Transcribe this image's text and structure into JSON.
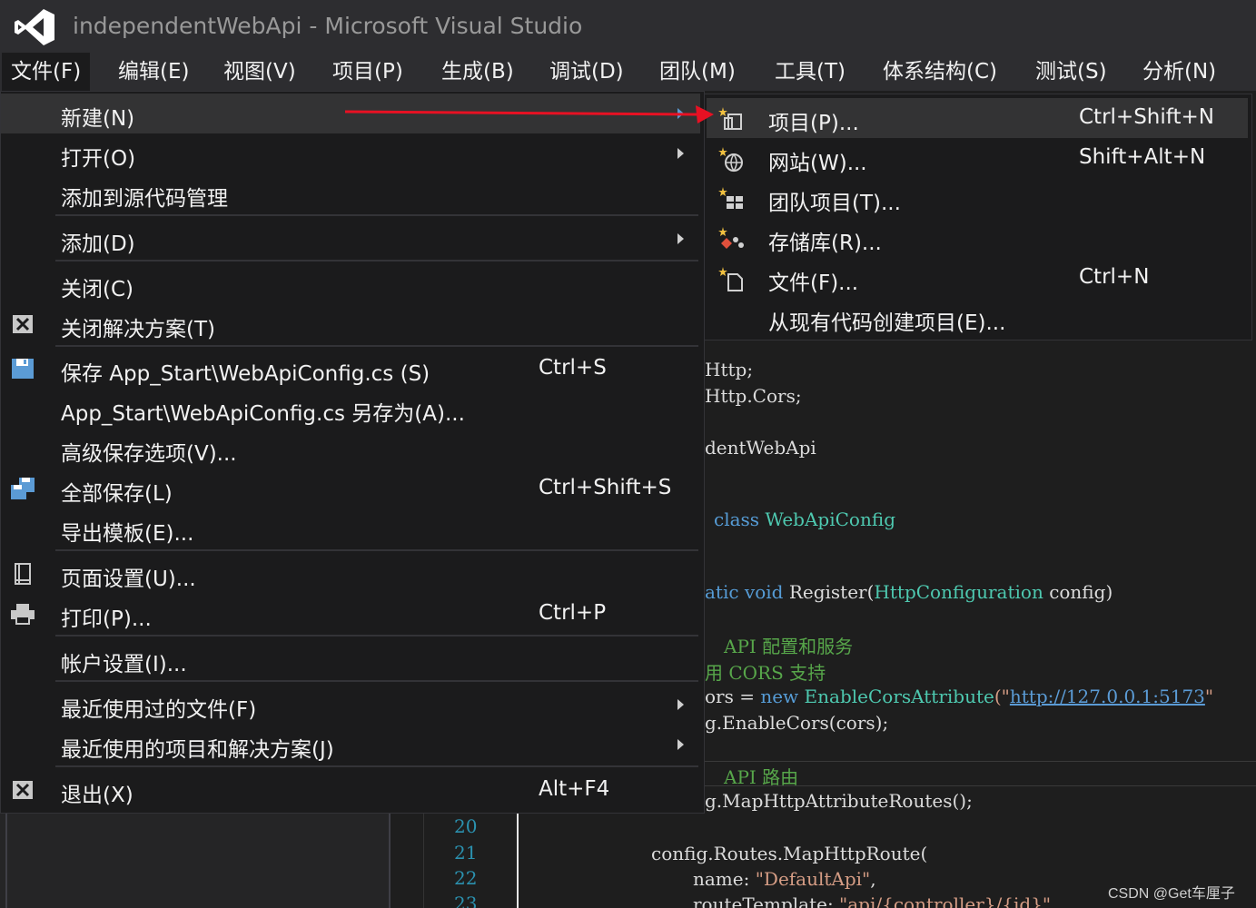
{
  "window": {
    "title": "independentWebApi - Microsoft Visual Studio"
  },
  "menubar": {
    "items": [
      "文件(F)",
      "编辑(E)",
      "视图(V)",
      "项目(P)",
      "生成(B)",
      "调试(D)",
      "团队(M)",
      "工具(T)",
      "体系结构(C)",
      "测试(S)",
      "分析(N)"
    ]
  },
  "file_menu": {
    "items": [
      {
        "label": "新建(N)",
        "shortcut": "",
        "icon": ""
      },
      {
        "label": "打开(O)",
        "shortcut": "",
        "icon": ""
      },
      {
        "label": "添加到源代码管理",
        "shortcut": "",
        "icon": ""
      },
      {
        "label": "添加(D)",
        "shortcut": "",
        "icon": ""
      },
      {
        "label": "关闭(C)",
        "shortcut": "",
        "icon": ""
      },
      {
        "label": "关闭解决方案(T)",
        "shortcut": "",
        "icon": "close-solution-icon"
      },
      {
        "label": "保存 App_Start\\WebApiConfig.cs (S)",
        "shortcut": "Ctrl+S",
        "icon": "save-icon"
      },
      {
        "label": "App_Start\\WebApiConfig.cs 另存为(A)...",
        "shortcut": "",
        "icon": ""
      },
      {
        "label": "高级保存选项(V)...",
        "shortcut": "",
        "icon": ""
      },
      {
        "label": "全部保存(L)",
        "shortcut": "Ctrl+Shift+S",
        "icon": "save-all-icon"
      },
      {
        "label": "导出模板(E)...",
        "shortcut": "",
        "icon": ""
      },
      {
        "label": "页面设置(U)...",
        "shortcut": "",
        "icon": "page-setup-icon"
      },
      {
        "label": "打印(P)...",
        "shortcut": "Ctrl+P",
        "icon": "print-icon"
      },
      {
        "label": "帐户设置(I)...",
        "shortcut": "",
        "icon": ""
      },
      {
        "label": "最近使用过的文件(F)",
        "shortcut": "",
        "icon": ""
      },
      {
        "label": "最近使用的项目和解决方案(J)",
        "shortcut": "",
        "icon": ""
      },
      {
        "label": "退出(X)",
        "shortcut": "Alt+F4",
        "icon": "exit-icon"
      }
    ]
  },
  "new_submenu": {
    "items": [
      {
        "label": "项目(P)...",
        "shortcut": "Ctrl+Shift+N",
        "icon": "new-project-icon"
      },
      {
        "label": "网站(W)...",
        "shortcut": "Shift+Alt+N",
        "icon": "new-website-icon"
      },
      {
        "label": "团队项目(T)...",
        "shortcut": "",
        "icon": "new-team-project-icon"
      },
      {
        "label": "存储库(R)...",
        "shortcut": "",
        "icon": "new-repository-icon"
      },
      {
        "label": "文件(F)...",
        "shortcut": "Ctrl+N",
        "icon": "new-file-icon"
      },
      {
        "label": "从现有代码创建项目(E)...",
        "shortcut": "",
        "icon": ""
      }
    ]
  },
  "editor": {
    "line_numbers": [
      "20",
      "21",
      "22",
      "23"
    ],
    "code": {
      "l1": "Http;",
      "l2": "Http.Cors;",
      "l3": "dentWebApi",
      "l4_kw": "class",
      "l4_type": "WebApiConfig",
      "l5_kw1": "atic",
      "l5_kw2": "void",
      "l5_name": "Register(",
      "l5_type": "HttpConfiguration",
      "l5_rest": "config)",
      "l6": "API 配置和服务",
      "l6_prefix": "",
      "l7": "用 CORS 支持",
      "l8_a": "ors = ",
      "l8_kw": "new",
      "l8_type": "EnableCorsAttribute",
      "l8_paren": "(\"",
      "l8_url": "http://127.0.0.1:5173",
      "l8_end": "\"",
      "l9": "g.EnableCors(cors);",
      "l10": "API 路由",
      "l11": "g.MapHttpAttributeRoutes();",
      "l12": "config.Routes.MapHttpRoute(",
      "l13_a": "name: ",
      "l13_str": "\"DefaultApi\"",
      "l13_b": ",",
      "l14_a": "routeTemplate: ",
      "l14_str": "\"api/{controller}/{id}\""
    }
  },
  "watermark": "CSDN @Get车厘子",
  "colors": {
    "menu_bg": "#1b1b1c",
    "menu_hover": "#333334",
    "arrow": "#e81123",
    "keyword": "#569cd6",
    "type": "#4ec9b0",
    "comment": "#57a64a",
    "string": "#d69d85"
  }
}
